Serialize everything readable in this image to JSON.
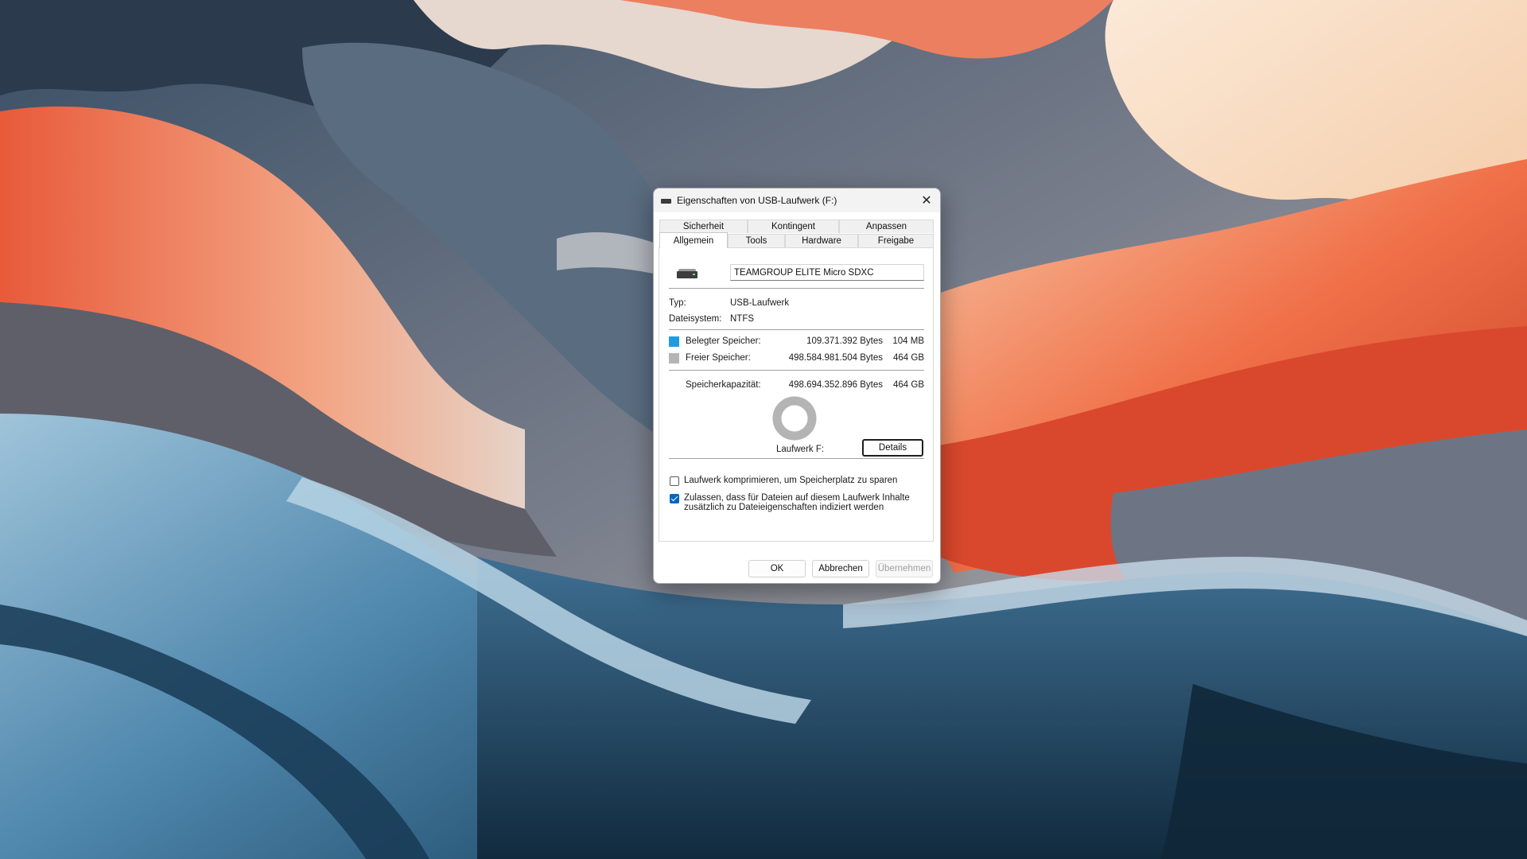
{
  "window": {
    "title": "Eigenschaften von USB-Laufwerk (F:)",
    "close_glyph": "✕"
  },
  "tabs": {
    "row_back": [
      "Sicherheit",
      "Kontingent",
      "Anpassen"
    ],
    "row_front": [
      "Allgemein",
      "Tools",
      "Hardware",
      "Freigabe"
    ],
    "active": "Allgemein"
  },
  "general": {
    "drive_name": "TEAMGROUP ELITE Micro SDXC",
    "type_label": "Typ:",
    "type_value": "USB-Laufwerk",
    "fs_label": "Dateisystem:",
    "fs_value": "NTFS",
    "used": {
      "label": "Belegter Speicher:",
      "bytes": "109.371.392 Bytes",
      "short": "104 MB",
      "color": "#1e9be0"
    },
    "free": {
      "label": "Freier Speicher:",
      "bytes": "498.584.981.504 Bytes",
      "short": "464 GB",
      "color": "#b4b4b4"
    },
    "capacity": {
      "label": "Speicherkapazität:",
      "bytes": "498.694.352.896 Bytes",
      "short": "464 GB"
    },
    "used_fraction": 0.0002,
    "drive_caption": "Laufwerk F:",
    "details_button": "Details",
    "compress_label": "Laufwerk komprimieren, um Speicherplatz zu sparen",
    "compress_checked": false,
    "index_label_line1": "Zulassen, dass für Dateien auf diesem Laufwerk Inhalte",
    "index_label_line2": "zusätzlich zu Dateieigenschaften indiziert werden",
    "index_checked": true
  },
  "footer": {
    "ok": "OK",
    "cancel": "Abbrechen",
    "apply": "Übernehmen"
  },
  "icons": {
    "drive": "usb-drive-icon",
    "close": "close-icon"
  }
}
